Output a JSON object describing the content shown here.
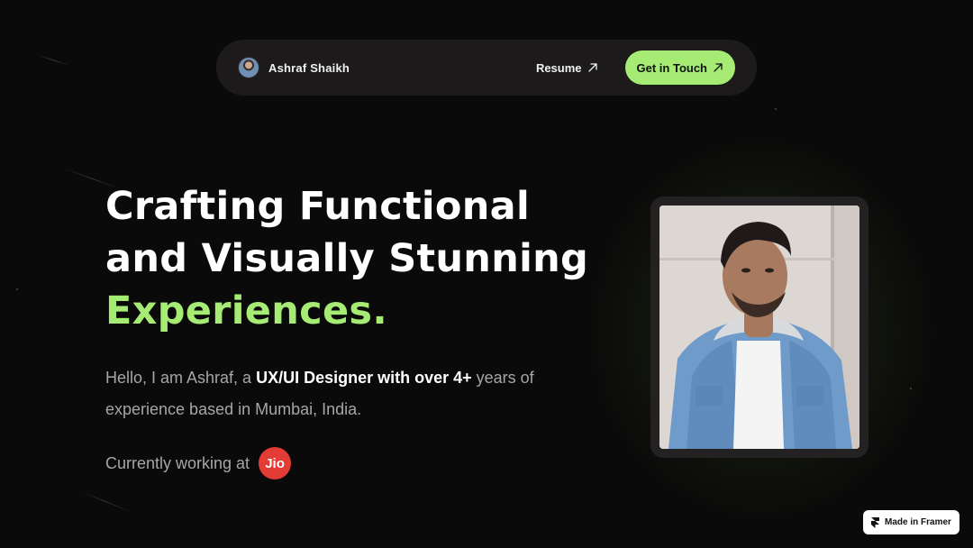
{
  "navbar": {
    "name": "Ashraf Shaikh",
    "resume_label": "Resume",
    "cta_label": "Get in Touch"
  },
  "hero": {
    "headline_line1": "Crafting Functional",
    "headline_line2": "and Visually Stunning",
    "headline_line3": "Experiences.",
    "intro_prefix": "Hello, I am Ashraf, a ",
    "intro_bold": "UX/UI Designer with over 4+",
    "intro_suffix": " years of experience based in Mumbai, India.",
    "working_label": "Currently working at",
    "company_logo_text": "Jio"
  },
  "badge": {
    "label": "Made in Framer"
  },
  "colors": {
    "background": "#0b0a0a",
    "accent_green": "#a6ec74",
    "navbar_bg": "#1c1a1b",
    "jio_red": "#e33b35",
    "muted_text": "#a8a5a5"
  },
  "icons": {
    "resume_arrow": "arrow-up-right-icon",
    "cta_arrow": "arrow-up-right-icon",
    "framer": "framer-logo-icon"
  }
}
